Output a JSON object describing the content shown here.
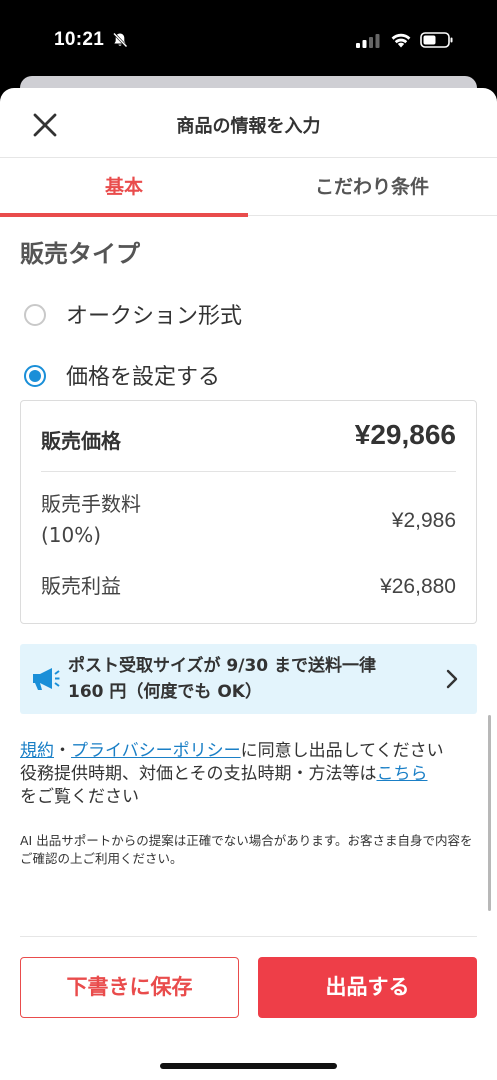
{
  "status_bar": {
    "time": "10:21"
  },
  "header": {
    "title": "商品の情報を入力"
  },
  "tabs": [
    {
      "label": "基本"
    },
    {
      "label": "こだわり条件"
    }
  ],
  "sale_type": {
    "title": "販売タイプ",
    "options": [
      {
        "label": "オークション形式",
        "selected": false
      },
      {
        "label": "価格を設定する",
        "selected": true
      }
    ]
  },
  "price_box": {
    "price_label": "販売価格",
    "price_value": "¥29,866",
    "fee_label_line1": "販売手数料",
    "fee_label_line2": "(10%)",
    "fee_value": "¥2,986",
    "profit_label": "販売利益",
    "profit_value": "¥26,880"
  },
  "banner": {
    "line1": "ポスト受取サイズが 9/30 まで送料一律",
    "line2": "160 円（何度でも OK）"
  },
  "terms": {
    "link_terms": "規約",
    "sep": "・",
    "link_privacy": "プライバシーポリシー",
    "text_agree": "に同意し出品してください",
    "text_service": "役務提供時期、対価とその支払時期・方法等は",
    "link_here": "こちら",
    "text_see": "をご覧ください",
    "ai_note": "AI 出品サポートからの提案は正確でない場合があります。お客さま自身で内容をご確認の上ご利用ください。"
  },
  "footer": {
    "draft_button": "下書きに保存",
    "list_button": "出品する"
  },
  "colors": {
    "accent_red": "#e94c4c",
    "link_blue": "#1a7fc6",
    "radio_blue": "#1a8fd8",
    "banner_bg": "#e3f4fc"
  },
  "icons": [
    "bell-slash-icon",
    "signal-icon",
    "wifi-icon",
    "battery-icon",
    "close-icon",
    "megaphone-icon",
    "chevron-right-icon"
  ]
}
